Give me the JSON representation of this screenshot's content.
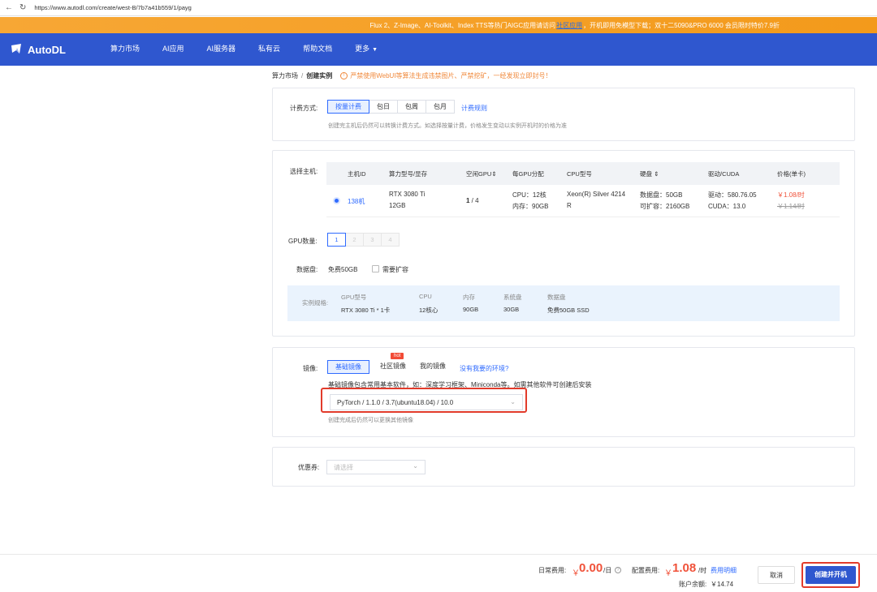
{
  "browser": {
    "back": "←",
    "refresh": "↻",
    "url": "https://www.autodl.com/create/west-B/7b7a41b559/1/payg"
  },
  "notice": {
    "text_pre": "Flux 2、Z-Image、AI-Toolkit、Index TTS等热门AIGC应用请访问",
    "link": "社区应用",
    "text_post": "，开机即用免模型下载；双十二5090&PRO 6000 会员限时特价7.9折"
  },
  "nav": {
    "logo": "AutoDL",
    "items": [
      "算力市场",
      "AI应用",
      "AI服务器",
      "私有云",
      "帮助文档",
      "更多"
    ]
  },
  "breadcrumb": {
    "parent": "算力市场",
    "sep": "/",
    "current": "创建实例",
    "warning": "严禁使用WebUI等算法生成违禁图片、严禁挖矿，一经发现立即封号！"
  },
  "billing": {
    "label": "计费方式:",
    "options": [
      "按量计费",
      "包日",
      "包周",
      "包月"
    ],
    "selected": "按量计费",
    "rules_link": "计费规则",
    "hint": "创建完主机后仍然可以转换计费方式。如选择按量计费，价格发生变动以实例开机时的价格为准"
  },
  "host": {
    "label": "选择主机:",
    "headers": {
      "id": "主机ID",
      "gpu_model": "算力型号/显存",
      "free_gpu": "空闲GPU",
      "per_gpu": "每GPU分配",
      "cpu_model": "CPU型号",
      "disk": "硬盘",
      "driver": "驱动/CUDA",
      "price": "价格(单卡)"
    },
    "sort_mark": "⇕",
    "row": {
      "id": "138机",
      "gpu_line1": "RTX 3080 Ti",
      "gpu_line2": "12GB",
      "free_gpu_strong": "1",
      "free_gpu_total": " / 4",
      "alloc_line1": "CPU：12核",
      "alloc_line2": "内存：90GB",
      "cpu_line1": "Xeon(R) Silver 4214",
      "cpu_line2": "R",
      "disk_line1": "数据盘：50GB",
      "disk_line2": "可扩容：2160GB",
      "driver_line1": "驱动：580.76.05",
      "driver_line2": "CUDA：13.0",
      "price": "￥1.08/时",
      "old_price": "￥1.14/时"
    }
  },
  "gpu_count": {
    "label": "GPU数量:",
    "options": [
      "1",
      "2",
      "3",
      "4"
    ],
    "selected": "1"
  },
  "data_disk": {
    "label": "数据盘:",
    "free": "免费50GB",
    "expand": "需要扩容"
  },
  "spec": {
    "label": "实例规格:",
    "items": [
      {
        "title": "GPU型号",
        "value": "RTX 3080 Ti * 1卡"
      },
      {
        "title": "CPU",
        "value": "12核心"
      },
      {
        "title": "内存",
        "value": "90GB"
      },
      {
        "title": "系统盘",
        "value": "30GB"
      },
      {
        "title": "数据盘",
        "value": "免费50GB SSD"
      }
    ]
  },
  "image": {
    "label": "镜像:",
    "tabs": [
      "基础镜像",
      "社区镜像",
      "我的镜像"
    ],
    "selected": "基础镜像",
    "hot": "hot",
    "missing_link": "没有我要的环境?",
    "desc": "基础镜像包含常用基本软件，如：深度学习框架、Miniconda等。如需其他软件可创建后安装",
    "value": "PyTorch / 1.1.0 / 3.7(ubuntu18.04) / 10.0",
    "hint": "创建完成后仍然可以更换其他镜像"
  },
  "coupon": {
    "label": "优惠券:",
    "placeholder": "请选择"
  },
  "footer": {
    "daily_label": "日常费用:",
    "daily_currency": "￥",
    "daily_value": "0.00",
    "daily_unit": "/日",
    "config_label": "配置费用:",
    "config_currency": "￥",
    "config_value": "1.08",
    "config_unit": "/时",
    "detail_link": "费用明细",
    "balance_label": "账户余额:",
    "balance_value": "￥14.74",
    "cancel": "取消",
    "create": "创建并开机"
  },
  "colors": {
    "brand": "#2f57cf",
    "accent": "#2f6bff",
    "price": "#f0523a",
    "highlight_border": "#e23b2b"
  }
}
